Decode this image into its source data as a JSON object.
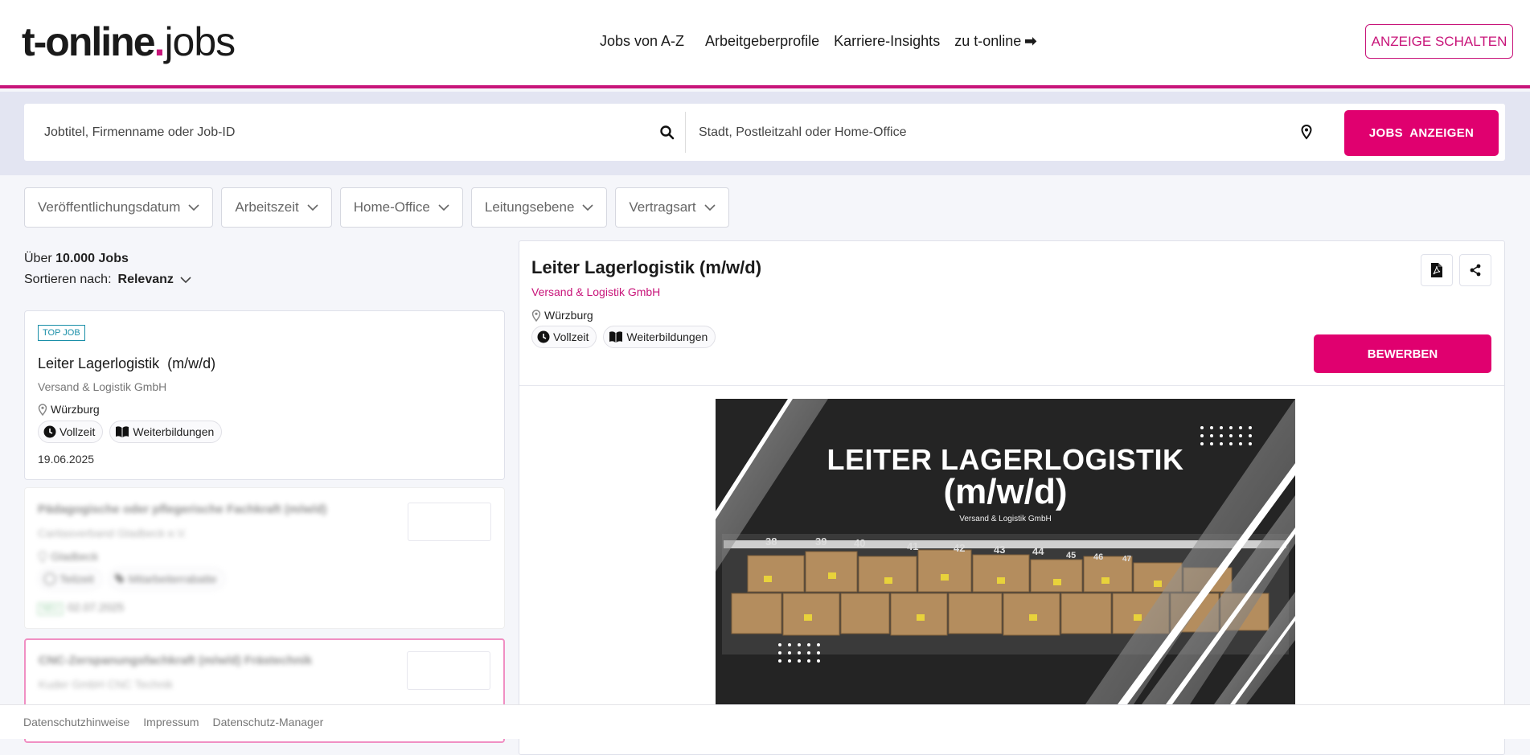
{
  "header": {
    "logo_main": "t-online",
    "logo_dot": ".",
    "logo_suffix": "jobs",
    "nav": [
      {
        "label": "Jobs von A-Z"
      },
      {
        "label": "Arbeitgeberprofile"
      },
      {
        "label": "Karriere-Insights"
      },
      {
        "label": "zu t-online"
      }
    ],
    "nav_arrow": "➡",
    "cta": "ANZEIGE SCHALTEN"
  },
  "search": {
    "query_placeholder": "Jobtitel, Firmenname oder Job-ID",
    "location_placeholder": "Stadt, Postleitzahl oder Home-Office",
    "submit": "JOBS  ANZEIGEN"
  },
  "filters": [
    "Veröffentlichungsdatum",
    "Arbeitszeit",
    "Home-Office",
    "Leitungsebene",
    "Vertragsart"
  ],
  "results": {
    "count_prefix": "Über",
    "count_value": "10.000",
    "count_suffix": "Jobs",
    "sort_label": "Sortieren nach:",
    "sort_value": "Relevanz"
  },
  "jobs": [
    {
      "badge": "TOP JOB",
      "title": "Leiter Lagerlogistik  (m/w/d)",
      "company": "Versand & Logistik GmbH",
      "location": "Würzburg",
      "tags": [
        "Vollzeit",
        "Weiterbildungen"
      ],
      "date": "19.06.2025"
    },
    {
      "title": "Pädagogische oder pflegerische Fachkraft (m/w/d)",
      "company": "Caritasverband Gladbeck e.V.",
      "location": "Gladbeck",
      "tags": [
        "Teilzeit",
        "Mitarbeiterrabatte"
      ],
      "new_badge": "NEU",
      "date": "02.07.2025"
    },
    {
      "title": "CNC-Zerspanungsfachkraft (m/w/d) Frästechnik",
      "company": "Kuder GmbH CNC Technik"
    }
  ],
  "detail": {
    "title": "Leiter Lagerlogistik (m/w/d)",
    "company": "Versand & Logistik GmbH",
    "location": "Würzburg",
    "tags": [
      "Vollzeit",
      "Weiterbildungen"
    ],
    "apply": "BEWERBEN",
    "banner": {
      "line1": "LEITER LAGERLOGISTIK",
      "line2": "(m/w/d)",
      "line3": "Versand & Logistik GmbH",
      "shelf_numbers": [
        "38",
        "39",
        "40",
        "41",
        "42",
        "43",
        "44",
        "45",
        "46",
        "47"
      ]
    }
  },
  "footer": [
    "Datenschutzhinweise",
    "Impressum",
    "Datenschutz-Manager"
  ],
  "colors": {
    "brand": "#e0006f",
    "accent_line": "#c8157a",
    "band": "#e3e5f2"
  }
}
